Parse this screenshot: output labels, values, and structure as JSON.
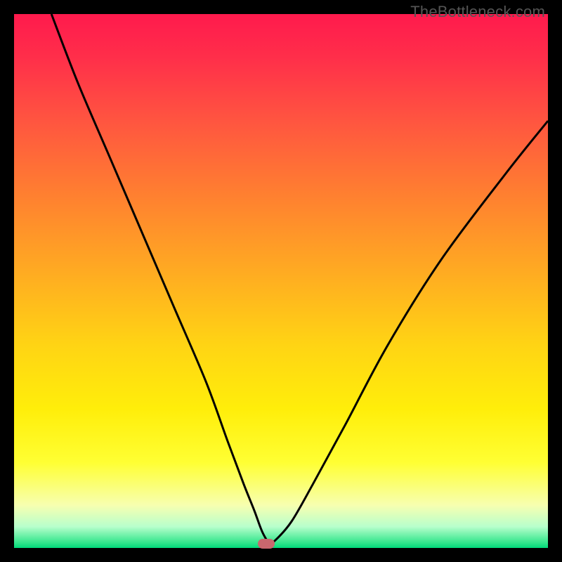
{
  "watermark": "TheBottleneck.com",
  "marker_color": "#c9676e",
  "curve_color": "#000000",
  "curve_stroke_width": 3,
  "chart_data": {
    "type": "line",
    "title": "",
    "xlabel": "",
    "ylabel": "",
    "xlim": [
      0,
      100
    ],
    "ylim": [
      0,
      100
    ],
    "grid": false,
    "series": [
      {
        "name": "bottleneck-curve",
        "x": [
          7,
          12,
          18,
          24,
          30,
          36,
          40,
          43,
          45,
          46.5,
          47.8,
          49,
          52,
          56,
          62,
          70,
          80,
          92,
          100
        ],
        "y": [
          100,
          87,
          73,
          59,
          45,
          31,
          20,
          12,
          7,
          3,
          1,
          1.5,
          5,
          12,
          23,
          38,
          54,
          70,
          80
        ]
      }
    ],
    "marker": {
      "x": 47.3,
      "y": 0.8
    },
    "gradient_stops": [
      {
        "pos": 0,
        "color": "#ff1a4d"
      },
      {
        "pos": 50,
        "color": "#ffaa22"
      },
      {
        "pos": 80,
        "color": "#ffff33"
      },
      {
        "pos": 100,
        "color": "#00d97a"
      }
    ]
  }
}
